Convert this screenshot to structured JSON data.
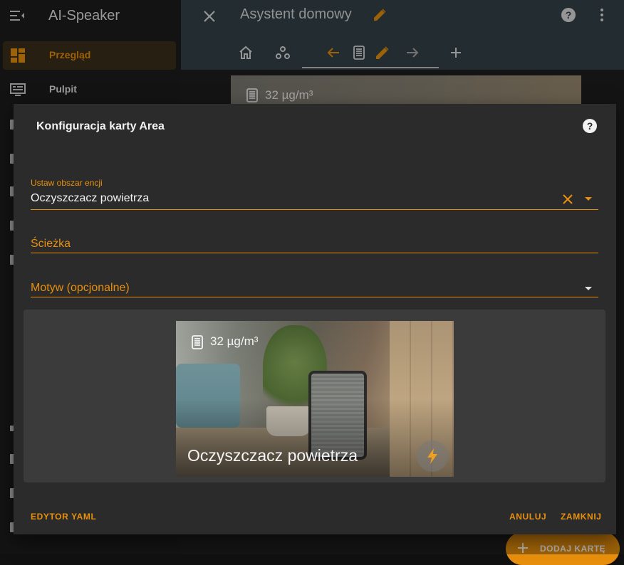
{
  "app": {
    "title": "AI-Speaker"
  },
  "sidebar": {
    "items": [
      {
        "label": "Przegląd",
        "icon": "dashboard-icon",
        "active": true
      },
      {
        "label": "Pulpit",
        "icon": "monitor-icon",
        "active": false
      }
    ]
  },
  "header": {
    "title": "Asystent domowy",
    "tabs": [
      "home-icon",
      "nodes-icon"
    ],
    "toolbar_icons": [
      "arrow-left-icon",
      "air-purifier-icon",
      "pencil-icon",
      "arrow-right-icon",
      "plus-icon"
    ]
  },
  "background_card": {
    "value": "32 µg/m³"
  },
  "fab": {
    "label": "DODAJ KARTĘ"
  },
  "dialog": {
    "title": "Konfiguracja karty Area",
    "fields": {
      "area": {
        "label": "Ustaw obszar encji",
        "value": "Oczyszczacz powietrza"
      },
      "path": {
        "placeholder": "Ścieżka"
      },
      "theme": {
        "placeholder": "Motyw (opcjonalne)"
      }
    },
    "preview": {
      "value": "32 µg/m³",
      "name": "Oczyszczacz powietrza"
    },
    "buttons": {
      "yaml": "EDYTOR YAML",
      "cancel": "ANULUJ",
      "close": "ZAMKNIJ"
    }
  },
  "colors": {
    "accent": "#e8900d",
    "header": "#344249",
    "dialog": "#2b2b2b"
  }
}
